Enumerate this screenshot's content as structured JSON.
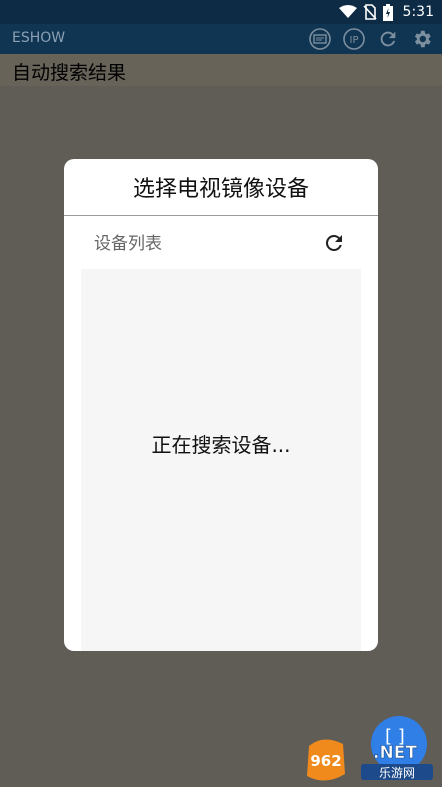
{
  "status_bar": {
    "time": "5:31"
  },
  "app_bar": {
    "title": "ESHOW",
    "icons": [
      "cast-icon",
      "ip-icon",
      "refresh-icon",
      "settings-icon"
    ]
  },
  "section": {
    "title": "自动搜索结果"
  },
  "dialog": {
    "title": "选择电视镜像设备",
    "list_label": "设备列表",
    "status": "正在搜索设备..."
  },
  "fab": {
    "glyph": "[ ]"
  },
  "watermark": {
    "brand": "962.NET",
    "sub": "乐游网"
  },
  "colors": {
    "status_bar": "#0d2b45",
    "app_bar": "#0f3553",
    "overlay": "#605d57",
    "dialog": "#ffffff",
    "panel": "#f6f6f6"
  }
}
